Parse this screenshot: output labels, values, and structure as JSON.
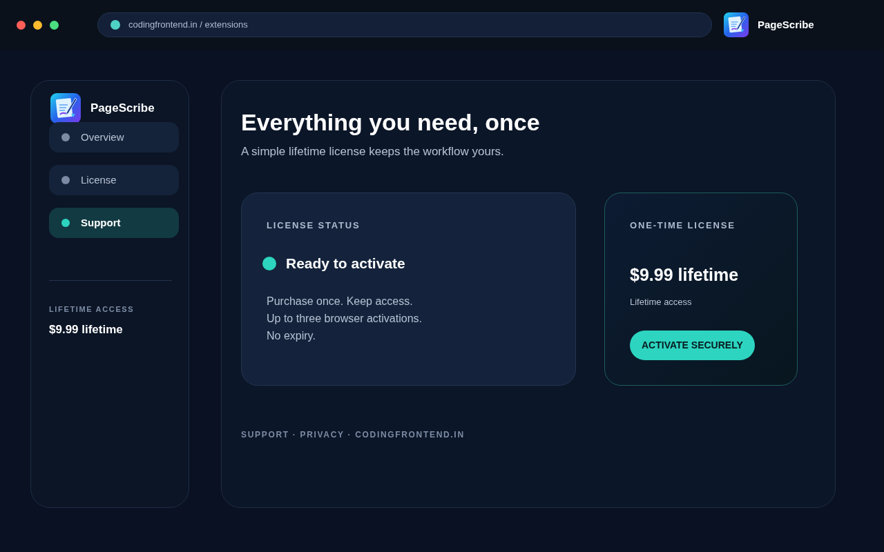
{
  "browser": {
    "url": "codingfrontend.in / extensions",
    "app_name": "PageScribe"
  },
  "sidebar": {
    "app_name": "PageScribe",
    "items": [
      {
        "label": "Overview",
        "selected": false
      },
      {
        "label": "License",
        "selected": false
      },
      {
        "label": "Support",
        "selected": true
      }
    ],
    "access_label": "LIFETIME ACCESS",
    "access_value": "$9.99 lifetime"
  },
  "main": {
    "title": "Everything you need, once",
    "subtitle": "A simple lifetime license keeps the workflow yours.",
    "status_card": {
      "label": "LICENSE STATUS",
      "status": "Ready to activate",
      "lines": [
        "Purchase once. Keep access.",
        "Up to three browser activations.",
        "No expiry."
      ]
    },
    "offer_card": {
      "label": "ONE-TIME LICENSE",
      "price": "$9.99 lifetime",
      "note": "Lifetime access",
      "button": "ACTIVATE SECURELY"
    },
    "footer": "SUPPORT · PRIVACY · CODINGFRONTEND.IN"
  }
}
